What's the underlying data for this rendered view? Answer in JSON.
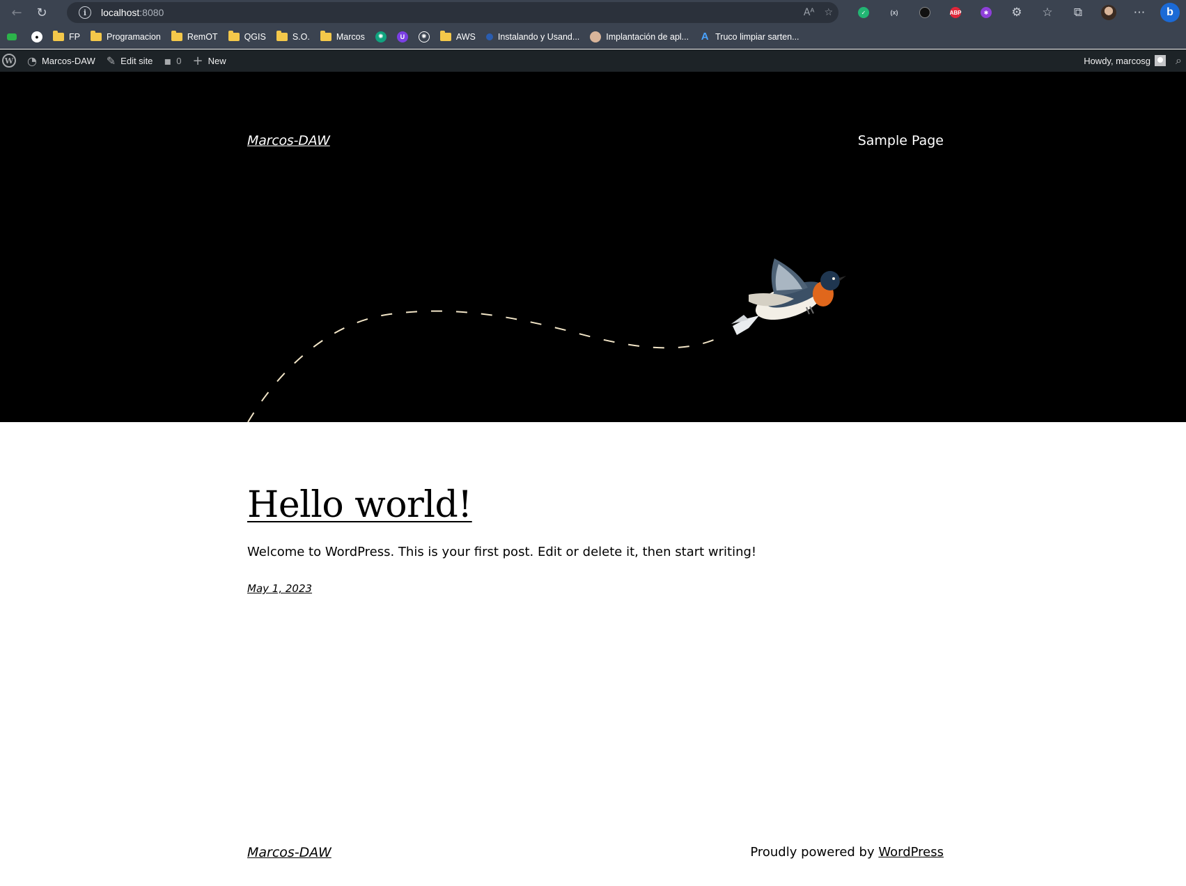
{
  "browser": {
    "url_host": "localhost",
    "url_port": ":8080",
    "bookmarks": [
      {
        "label": "FP",
        "kind": "folder"
      },
      {
        "label": "Programacion",
        "kind": "folder"
      },
      {
        "label": "RemOT",
        "kind": "folder"
      },
      {
        "label": "QGIS",
        "kind": "folder"
      },
      {
        "label": "S.O.",
        "kind": "folder"
      },
      {
        "label": "Marcos",
        "kind": "folder"
      },
      {
        "label": "AWS",
        "kind": "folder"
      },
      {
        "label": "Instalando y Usand...",
        "kind": "site"
      },
      {
        "label": "Implantación de apl...",
        "kind": "site"
      },
      {
        "label": "Truco limpiar sarten...",
        "kind": "site"
      }
    ],
    "extensions": [
      {
        "name": "shield-check-extension-icon",
        "text": "",
        "color": "#22b573"
      },
      {
        "name": "bracket-extension-icon",
        "text": "(x)",
        "color": "#3b4350"
      },
      {
        "name": "shield-extension-icon",
        "text": "",
        "color": "#111111"
      },
      {
        "name": "adblock-plus-icon",
        "text": "ABP",
        "color": "#e0273a"
      },
      {
        "name": "purple-extension-icon",
        "text": "",
        "color": "#8e3fd9"
      }
    ]
  },
  "adminbar": {
    "site_name": "Marcos-DAW",
    "edit_site": "Edit site",
    "comments_count": "0",
    "new_label": "New",
    "howdy": "Howdy, marcosg"
  },
  "site": {
    "title": "Marcos-DAW",
    "nav_item": "Sample Page"
  },
  "post": {
    "title": "Hello world!",
    "excerpt": "Welcome to WordPress. This is your first post. Edit or delete it, then start writing!",
    "date": "May 1, 2023"
  },
  "footer": {
    "site_title": "Marcos-DAW",
    "credit_prefix": "Proudly powered by ",
    "credit_link": "WordPress"
  },
  "colors": {
    "chrome_bg": "#3b4350",
    "adminbar_bg": "#1d2327",
    "hero_bg": "#000000",
    "flight_path": "#f3e6c8"
  }
}
